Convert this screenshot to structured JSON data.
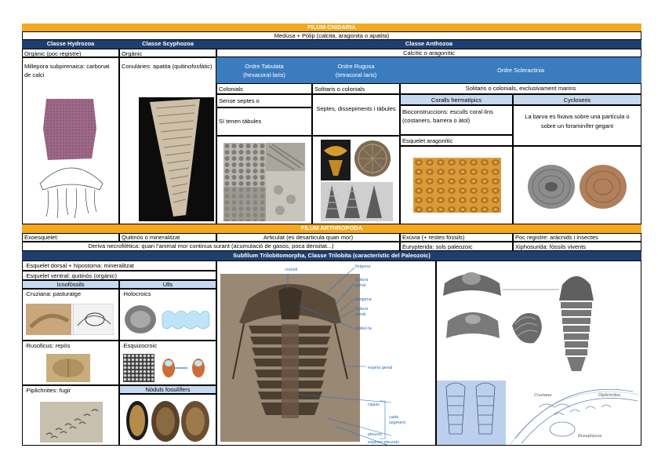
{
  "cnidaria": {
    "title": "FILUM CNIDARIA",
    "subtitle": "Medusa + Pòlip (calcita, aragonita o apatita)",
    "hydrozoa": {
      "header": "Classe Hydrozoa",
      "composition": "Orgànic (poc registre)",
      "example": "Millepora subpirenaica: carbonat de calci"
    },
    "scyphozoa": {
      "header": "Classe Scyphozoa",
      "composition": "Orgànic",
      "example": "Conulàries: apatita (quitinofosfàtic)"
    },
    "anthozoa": {
      "header": "Classe Anthozoa",
      "composition": "Calcític o aragonític",
      "tabulata": {
        "header_line1": "Ordre Tabulata",
        "header_line2": "(hexacoral·laris)",
        "row1": "Colonials",
        "row2": "Sense septes o",
        "row3": "Sí tenen tàbules"
      },
      "rugosa": {
        "header_line1": "Ordre Rugosa",
        "header_line2": "(tetracoral·laris)",
        "row1": "Solitaris o colonials",
        "row2": "Septes, dissepiments i tàbules"
      },
      "scleractinia": {
        "header": "Ordre Scleractinia",
        "row1": "Solitaris o colonials, exclusivament marins",
        "hermatipics": {
          "header": "Coralls hermatípics",
          "text": "Bioconstruccions: esculls coral·lins (costaners, barrera o àtol)",
          "extra": "Esquelet aragonític"
        },
        "cycloseris": {
          "header": "Cycloseris",
          "text": "La barva es fixava sobre una partícula o sobre un foraminífer gegant"
        }
      }
    }
  },
  "arthropoda": {
    "title": "FILUM ARTHROPODA",
    "row1": {
      "a": "Exoesquelet:",
      "b": "Quitinós o mineralitzat",
      "c": "Articulat (es desarticula quan mor)",
      "d": "Exúvia (+ restes fòssils)",
      "e": "Poc registre: aràcnids i insectes"
    },
    "row2": {
      "a": "Deriva necrofilètica: quan l’animal mor continua surant (acumulació de gasos, poca densitat...)",
      "b": "Eurypterida: sols paleozoic",
      "c": "Xiphosurida: fòssils vivents"
    },
    "trilobita_header": "Subfílum Trilobitomorpha, Classe Trilobita (característic del Paleozoic)",
    "left": {
      "line1": "·Esquelet dorsal + hipostoma: mineralitzat",
      "line2": "·Esquelet ventral: quitinós (orgànic)",
      "icno_header": "Icnofòssils",
      "ulls_header": "Ulls",
      "cruziana": "·Cruziana: pasturatge",
      "holocroics": "·Holocroics",
      "rusoficus": "·Rusoficus: repòs",
      "esquizocroic": "·Esquizocroic",
      "piplichnites": "·Piplichnites: fugir",
      "noduls": "Nòduls fossilífers"
    },
    "trilobite_labels": {
      "cranidi": "cranidi",
      "flexigena": "fixígena",
      "sutura1": "Sutura",
      "sutura1b": "genal",
      "librigena": "librigena",
      "sutura2": "Sutura",
      "sutura2b": "genal",
      "glabel": "glabel·la",
      "espina_genal": "espina genal",
      "raquis": "raquis",
      "cada": "cada",
      "segment": "segment",
      "pleures": "pleures",
      "espines": "espines pleurals"
    },
    "trace_labels": {
      "cruziana": "Cruziana",
      "diplichnites": "Diplichnites",
      "rusophycus": "Rusophycus"
    }
  }
}
